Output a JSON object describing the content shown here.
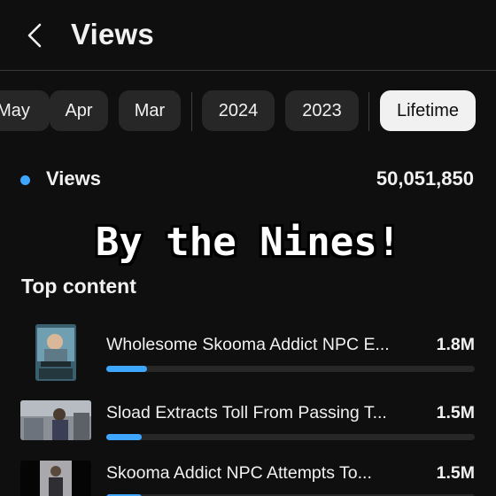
{
  "header": {
    "title": "Views"
  },
  "filters": {
    "chips": [
      {
        "label": "May",
        "selected": false
      },
      {
        "label": "Apr",
        "selected": false
      },
      {
        "label": "Mar",
        "selected": false
      },
      {
        "label": "2024",
        "selected": false
      },
      {
        "label": "2023",
        "selected": false
      },
      {
        "label": "Lifetime",
        "selected": true
      }
    ]
  },
  "metric": {
    "label": "Views",
    "value": "50,051,850",
    "dot_color": "#3ea6ff"
  },
  "overlay": {
    "caption": "By the Nines!"
  },
  "top_content": {
    "title": "Top content",
    "items": [
      {
        "title": "Wholesome Skooma Addict NPC E...",
        "views": "1.8M",
        "share": 0.11
      },
      {
        "title": "Sload Extracts Toll From Passing T...",
        "views": "1.5M",
        "share": 0.095
      },
      {
        "title": "Skooma Addict NPC Attempts To...",
        "views": "1.5M",
        "share": 0.095
      }
    ]
  },
  "colors": {
    "accent": "#3ea6ff",
    "background": "#0f0f0f",
    "chip": "#272727",
    "chip_selected": "#f1f1f1"
  }
}
